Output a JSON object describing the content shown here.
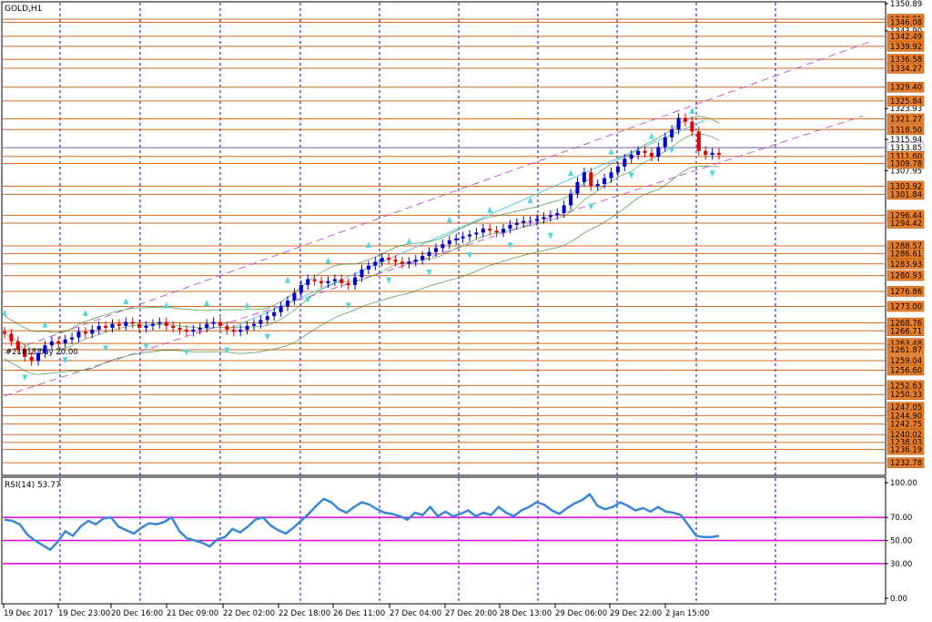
{
  "chart_data": [
    {
      "type": "candlestick",
      "title": "GOLD,H1",
      "ylim": [
        1230.0,
        1350.89
      ],
      "grid": true,
      "x_tick_labels": [
        "19 Dec 2017",
        "19 Dec 23:00",
        "20 Dec 16:00",
        "21 Dec 09:00",
        "22 Dec 02:00",
        "22 Dec 18:00",
        "26 Dec 11:00",
        "27 Dec 04:00",
        "27 Dec 20:00",
        "28 Dec 13:00",
        "29 Dec 06:00",
        "29 Dec 22:00",
        "2 Jan 15:00"
      ],
      "y_scale_labels": [
        "1350.89",
        "1343.90",
        "1323.93",
        "1315.94",
        "1307.95"
      ],
      "price_levels": [
        "1346.91",
        "1346.08",
        "1342.49",
        "1339.92",
        "1336.58",
        "1334.27",
        "1329.40",
        "1325.84",
        "1321.27",
        "1318.50",
        "1313.85",
        "1311.60",
        "1309.78",
        "1303.92",
        "1301.84",
        "1296.44",
        "1294.42",
        "1288.57",
        "1286.61",
        "1283.93",
        "1280.93",
        "1276.86",
        "1273.00",
        "1268.76",
        "1266.71",
        "1263.48",
        "1261.87",
        "1259.04",
        "1256.60",
        "1252.63",
        "1250.33",
        "1247.05",
        "1244.90",
        "1242.75",
        "1240.02",
        "1238.03",
        "1236.19",
        "1232.78"
      ],
      "annotation": "#21818 buy 20.00",
      "close_series": [
        1266.0,
        1264.0,
        1262.0,
        1260.0,
        1259.0,
        1261.0,
        1263.0,
        1264.0,
        1263.5,
        1264.5,
        1265.0,
        1266.5,
        1266.0,
        1267.0,
        1268.0,
        1267.5,
        1268.5,
        1268.0,
        1269.0,
        1268.5,
        1267.5,
        1268.0,
        1268.5,
        1269.0,
        1268.0,
        1267.5,
        1267.0,
        1266.5,
        1267.0,
        1267.5,
        1268.5,
        1269.0,
        1268.0,
        1267.0,
        1266.5,
        1267.0,
        1268.0,
        1268.5,
        1269.5,
        1270.5,
        1271.5,
        1273.0,
        1274.5,
        1276.5,
        1278.5,
        1280.0,
        1279.5,
        1279.0,
        1279.5,
        1280.0,
        1279.0,
        1278.5,
        1280.5,
        1282.5,
        1283.5,
        1284.5,
        1285.5,
        1285.0,
        1284.5,
        1284.0,
        1284.5,
        1285.0,
        1286.0,
        1287.0,
        1288.0,
        1289.0,
        1290.0,
        1290.5,
        1291.0,
        1291.5,
        1292.0,
        1293.0,
        1292.5,
        1292.0,
        1293.0,
        1294.0,
        1294.5,
        1295.0,
        1295.0,
        1295.5,
        1296.0,
        1296.5,
        1297.0,
        1299.0,
        1302.0,
        1305.0,
        1307.5,
        1304.0,
        1304.5,
        1306.0,
        1307.5,
        1309.0,
        1311.0,
        1312.0,
        1313.0,
        1312.5,
        1311.5,
        1314.0,
        1316.5,
        1318.5,
        1321.5,
        1320.5,
        1318.0,
        1313.0,
        1312.0,
        1312.5,
        1312.0
      ],
      "rsi": {
        "label": "RSI(14) 53.77",
        "ylim": [
          0,
          100
        ],
        "levels": [
          70,
          50,
          30
        ],
        "y_tick_labels": [
          "100.00",
          "70.00",
          "50.00",
          "30.00",
          "0.00"
        ],
        "values": [
          68,
          67,
          64,
          55,
          50,
          46,
          42,
          49,
          58,
          54,
          62,
          67,
          64,
          69,
          70,
          62,
          59,
          56,
          61,
          65,
          64,
          66,
          70,
          58,
          52,
          50,
          48,
          45,
          51,
          53,
          60,
          57,
          62,
          68,
          70,
          63,
          59,
          56,
          61,
          67,
          73,
          80,
          86,
          83,
          77,
          74,
          79,
          83,
          81,
          77,
          74,
          73,
          71,
          68,
          74,
          72,
          79,
          71,
          75,
          71,
          73,
          76,
          71,
          74,
          72,
          79,
          74,
          71,
          76,
          79,
          83,
          81,
          76,
          73,
          78,
          82,
          85,
          90,
          80,
          77,
          79,
          83,
          80,
          76,
          78,
          75,
          79,
          75,
          74,
          72,
          63,
          54,
          53,
          53,
          54
        ]
      }
    }
  ],
  "colors": {
    "level_line": "#d2691e",
    "level_box": "#e87e2a",
    "bull_candle": "#0000cc",
    "bear_candle": "#e00000",
    "grid": "#0000cc",
    "band": "#2e8b2e",
    "channel": "#c55ad4",
    "arrow": "#4fd6e0",
    "rsi_line": "#3a86d6",
    "rsi_level": "#e000e0",
    "scale_line": "#000000"
  }
}
